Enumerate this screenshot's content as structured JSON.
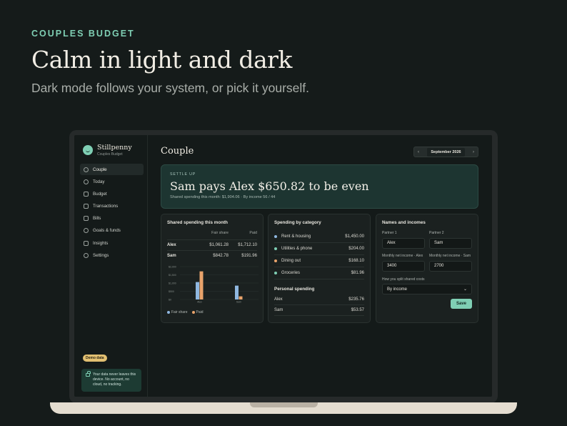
{
  "hero": {
    "eyebrow": "COUPLES BUDGET",
    "headline": "Calm in light and dark",
    "subhead": "Dark mode follows your system, or pick it yourself."
  },
  "app": {
    "brand": {
      "name": "Stillpenny",
      "subtitle": "Couples Budget"
    },
    "nav": [
      {
        "label": "Couple",
        "icon": "users-icon",
        "active": true
      },
      {
        "label": "Today",
        "icon": "sun-icon"
      },
      {
        "label": "Budget",
        "icon": "wallet-icon"
      },
      {
        "label": "Transactions",
        "icon": "list-icon"
      },
      {
        "label": "Bills",
        "icon": "calendar-icon"
      },
      {
        "label": "Goals & funds",
        "icon": "target-icon"
      },
      {
        "label": "Insights",
        "icon": "chart-icon"
      },
      {
        "label": "Settings",
        "icon": "gear-icon"
      }
    ],
    "demo_badge": "Demo data",
    "privacy_note": "Your data never leaves this device. No account, no cloud, no tracking.",
    "page_title": "Couple",
    "month": {
      "label": "September 2026",
      "prev": "‹",
      "next": "›"
    },
    "settle": {
      "eyebrow": "SETTLE UP",
      "amount": "Sam pays Alex $650.82 to be even",
      "detail": "Shared spending this month: $1,904.06 · By income 56 / 44"
    },
    "shared": {
      "title": "Shared spending this month",
      "col_fair": "Fair share",
      "col_paid": "Paid",
      "rows": [
        {
          "name": "Alex",
          "fair": "$1,061.28",
          "paid": "$1,712.10"
        },
        {
          "name": "Sam",
          "fair": "$842.78",
          "paid": "$191.96"
        }
      ],
      "legend_fair": "Fair share",
      "legend_paid": "Paid"
    },
    "category": {
      "title": "Spending by category",
      "rows": [
        {
          "name": "Rent & housing",
          "amount": "$1,450.00",
          "color": "#8fb7e0"
        },
        {
          "name": "Utilities & phone",
          "amount": "$204.00",
          "color": "#7fcfb4"
        },
        {
          "name": "Dining out",
          "amount": "$168.10",
          "color": "#e9a36b"
        },
        {
          "name": "Groceries",
          "amount": "$81.96",
          "color": "#7fcfb4"
        }
      ],
      "personal_title": "Personal spending",
      "personal": [
        {
          "name": "Alex",
          "amount": "$235.76"
        },
        {
          "name": "Sam",
          "amount": "$53.57"
        }
      ]
    },
    "incomes": {
      "title": "Names and incomes",
      "partner1_label": "Partner 1",
      "partner1_value": "Alex",
      "partner2_label": "Partner 2",
      "partner2_value": "Sam",
      "income1_label": "Monthly net income · Alex",
      "income1_value": "3400",
      "income2_label": "Monthly net income · Sam",
      "income2_value": "2700",
      "split_label": "How you split shared costs",
      "split_value": "By income",
      "save_label": "Save"
    }
  },
  "chart_data": {
    "type": "bar",
    "categories": [
      "Alex",
      "Sam"
    ],
    "series": [
      {
        "name": "Fair share",
        "values": [
          1061.28,
          842.78
        ],
        "color": "#8fb7e0"
      },
      {
        "name": "Paid",
        "values": [
          1712.1,
          191.96
        ],
        "color": "#e9a36b"
      }
    ],
    "ylim": [
      0,
      2000
    ],
    "yticks": [
      "$2,000",
      "$1,500",
      "$1,000",
      "$500",
      "$0"
    ],
    "grid": true,
    "legend": "bottom-left"
  },
  "colors": {
    "accent": "#7fcfb4",
    "settle_bg": "#1d3531",
    "badge": "#e2c072"
  }
}
